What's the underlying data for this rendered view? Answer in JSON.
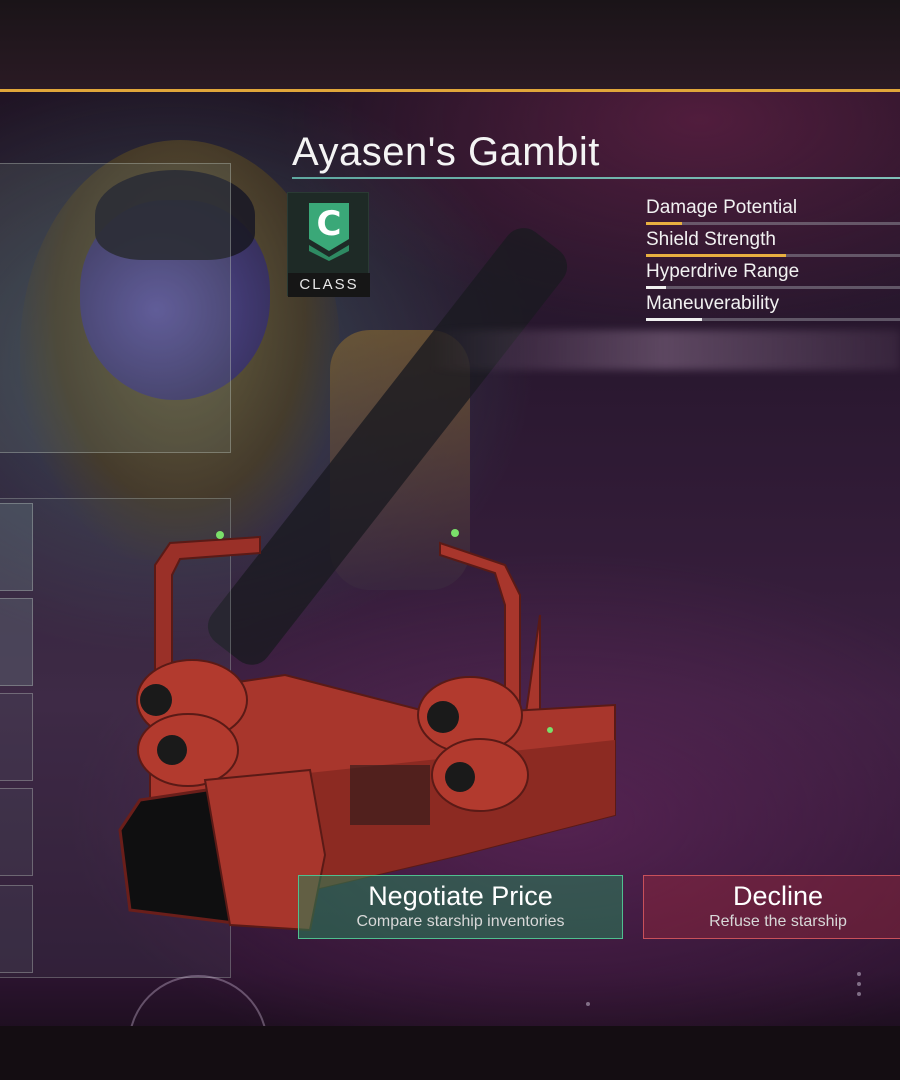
{
  "ship": {
    "name": "Ayasen's Gambit",
    "class_letter": "C",
    "class_label": "CLASS"
  },
  "stats": [
    {
      "label": "Damage Potential",
      "level": 0.14,
      "color": "#e8b040"
    },
    {
      "label": "Shield Strength",
      "level": 0.55,
      "color": "#e8b040"
    },
    {
      "label": "Hyperdrive Range",
      "level": 0.08,
      "color": "#f0f0f0"
    },
    {
      "label": "Maneuverability",
      "level": 0.22,
      "color": "#f0f0f0"
    }
  ],
  "actions": {
    "negotiate": {
      "title": "Negotiate Price",
      "subtitle": "Compare starship inventories"
    },
    "decline": {
      "title": "Decline",
      "subtitle": "Refuse the starship"
    }
  },
  "colors": {
    "accent_gold": "#e0a63a",
    "accent_teal": "#5fa8a0",
    "class_c_green": "#3aa878",
    "negotiate_green": "#4fbf8f",
    "decline_red": "#c8505a",
    "ship_red": "#a8362c"
  }
}
